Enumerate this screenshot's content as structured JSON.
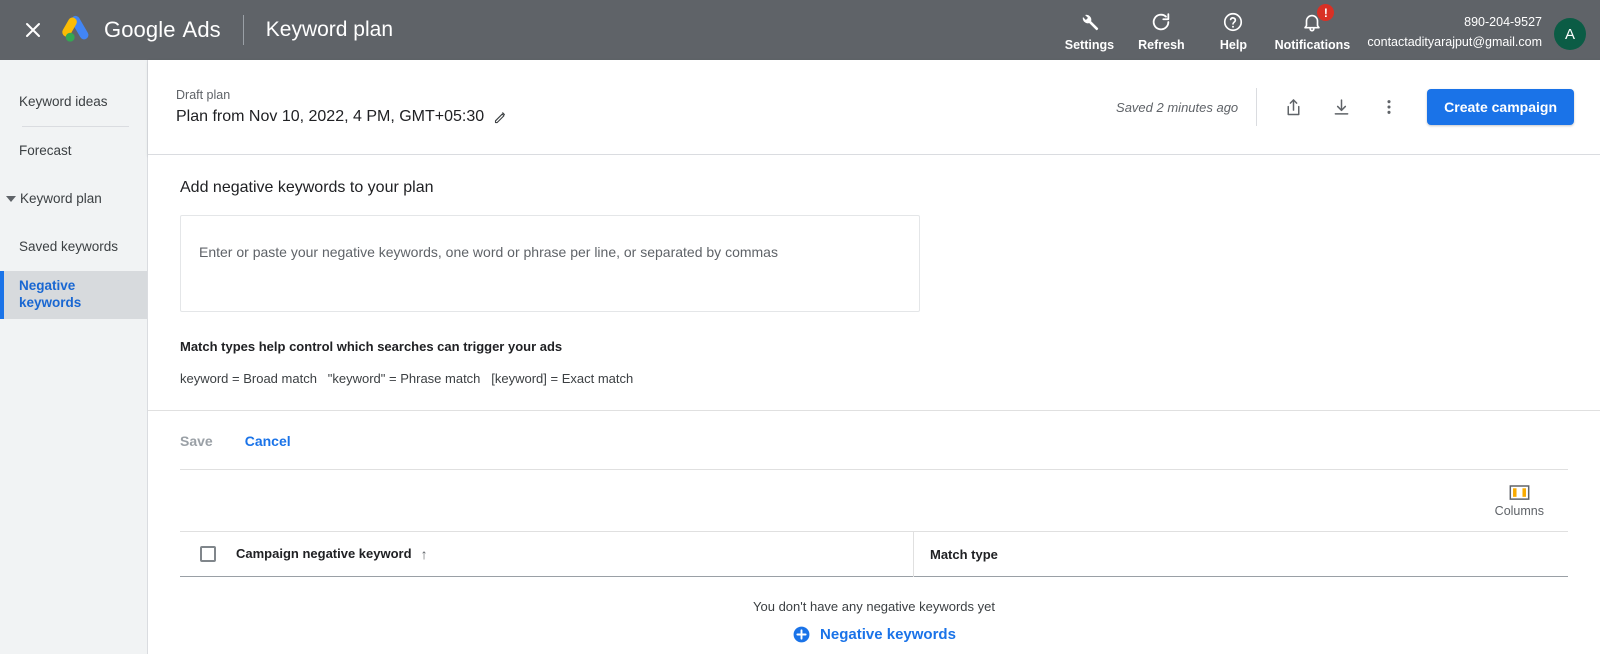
{
  "header": {
    "close_icon": "close-icon",
    "brand_google": "Google",
    "brand_ads": "Ads",
    "page_title": "Keyword plan",
    "items": [
      {
        "label": "Settings",
        "icon": "wrench-icon"
      },
      {
        "label": "Refresh",
        "icon": "refresh-icon"
      },
      {
        "label": "Help",
        "icon": "help-circle-icon"
      },
      {
        "label": "Notifications",
        "icon": "bell-icon",
        "badge": "!"
      }
    ],
    "account_id": "890-204-9527",
    "account_email": "contactadityarajput@gmail.com",
    "avatar_initial": "A",
    "avatar_color": "#0b5c45",
    "bar_color": "#5f6368"
  },
  "sidebar": {
    "items": [
      {
        "label": "Keyword ideas",
        "type": "link",
        "selected": false
      },
      {
        "label": "Forecast",
        "type": "link",
        "selected": false
      },
      {
        "label": "Keyword plan",
        "type": "group",
        "selected": false
      },
      {
        "label": "Saved keywords",
        "type": "child",
        "selected": false
      },
      {
        "label": "Negative keywords",
        "type": "child",
        "selected": true
      }
    ],
    "selected_color": "#1967d2"
  },
  "planbar": {
    "kicker": "Draft plan",
    "name": "Plan from Nov 10, 2022, 4 PM, GMT+05:30",
    "edit_icon": "pencil-icon",
    "saved_text": "Saved 2 minutes ago",
    "share_icon": "share-icon",
    "download_icon": "download-icon",
    "more_icon": "more-vert-icon",
    "create_campaign_label": "Create campaign",
    "accent_color": "#1a73e8"
  },
  "main": {
    "section_title": "Add negative keywords to your plan",
    "textarea_value": "",
    "textarea_placeholder": "Enter or paste your negative keywords, one word or phrase per line, or separated by commas",
    "match_types_title": "Match types help control which searches can trigger your ads",
    "match_types_line": "keyword = Broad match   \"keyword\" = Phrase match   [keyword] = Exact match",
    "save_label": "Save",
    "save_disabled": true,
    "cancel_label": "Cancel"
  },
  "toolbar": {
    "columns_label": "Columns",
    "columns_icon": "columns-icon"
  },
  "table": {
    "columns": [
      {
        "label": "Campaign negative keyword",
        "sorted": true,
        "sort_icon": "arrow-up-icon"
      },
      {
        "label": "Match type",
        "sorted": false
      }
    ],
    "rows": [],
    "empty_text": "You don't have any negative keywords yet",
    "empty_action_label": "Negative keywords",
    "empty_action_icon": "plus-circle-icon"
  }
}
